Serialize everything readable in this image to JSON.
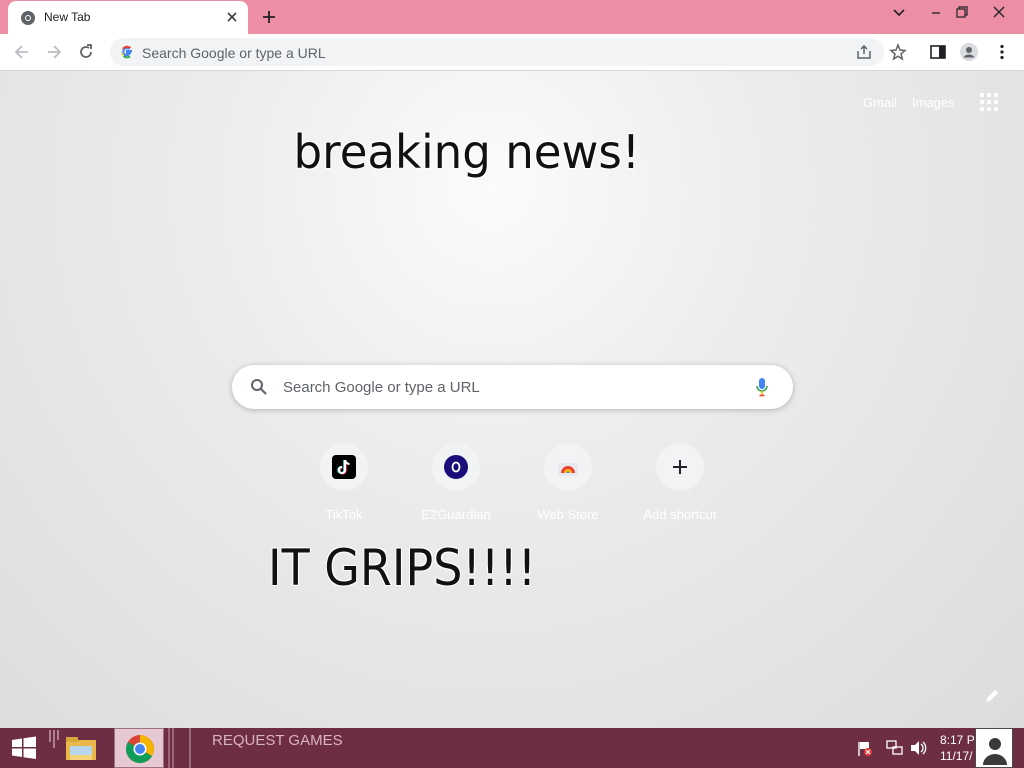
{
  "browser": {
    "tab": {
      "title": "New Tab"
    },
    "omnibox": {
      "placeholder": "Search Google or type a URL"
    }
  },
  "ntp": {
    "header_links": [
      "Gmail",
      "Images"
    ],
    "overlay_text": {
      "headline": "breaking news!",
      "tagline": "IT GRIPS!!!!"
    },
    "search": {
      "placeholder": "Search Google or type a URL"
    },
    "shortcuts": [
      {
        "label": "TikTok",
        "icon": "tiktok-icon"
      },
      {
        "label": "E2Guardian",
        "icon": "e2guardian-icon"
      },
      {
        "label": "Web Store",
        "icon": "web-store-icon"
      },
      {
        "label": "Add shortcut",
        "icon": "plus-icon"
      }
    ]
  },
  "taskbar": {
    "pinned_text": "REQUEST GAMES",
    "clock": {
      "time": "8:17 P",
      "date": "11/17/"
    }
  },
  "colors": {
    "titlebar": "#ec8fa5",
    "taskbar": "#6d2e44",
    "e2guardian_tile": "#1a0f7a"
  }
}
